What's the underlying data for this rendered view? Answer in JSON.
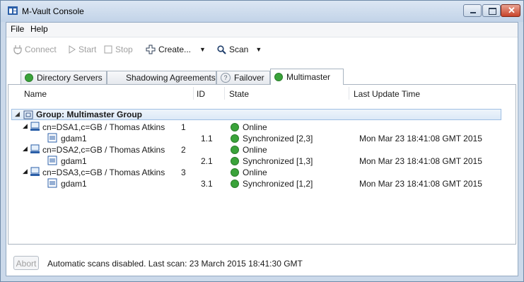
{
  "window": {
    "title": "M-Vault Console"
  },
  "menu": {
    "items": [
      "File",
      "Help"
    ]
  },
  "toolbar": {
    "connect": "Connect",
    "start": "Start",
    "stop": "Stop",
    "create": "Create...",
    "scan": "Scan"
  },
  "tabs": [
    "Directory Servers",
    "Shadowing Agreements",
    "Failover",
    "Multimaster"
  ],
  "table": {
    "columns": [
      "Name",
      "ID",
      "State",
      "Last Update Time"
    ],
    "group": "Group: Multimaster Group",
    "rows": [
      {
        "name": "cn=DSA1,c=GB / Thomas Atkins",
        "id": "1",
        "state": "Online",
        "time": ""
      },
      {
        "name": "gdam1",
        "id": "1.1",
        "state": "Synchronized [2,3]",
        "time": "Mon Mar 23 18:41:08 GMT 2015"
      },
      {
        "name": "cn=DSA2,c=GB / Thomas Atkins",
        "id": "2",
        "state": "Online",
        "time": ""
      },
      {
        "name": "gdam1",
        "id": "2.1",
        "state": "Synchronized [1,3]",
        "time": "Mon Mar 23 18:41:08 GMT 2015"
      },
      {
        "name": "cn=DSA3,c=GB / Thomas Atkins",
        "id": "3",
        "state": "Online",
        "time": ""
      },
      {
        "name": "gdam1",
        "id": "3.1",
        "state": "Synchronized [1,2]",
        "time": "Mon Mar 23 18:41:08 GMT 2015"
      }
    ]
  },
  "status": {
    "abort": "Abort",
    "text": "Automatic scans disabled. Last scan: 23 March 2015 18:41:30 GMT"
  },
  "colors": {
    "online": "#3aa33a",
    "selection": "#dce9f7"
  }
}
